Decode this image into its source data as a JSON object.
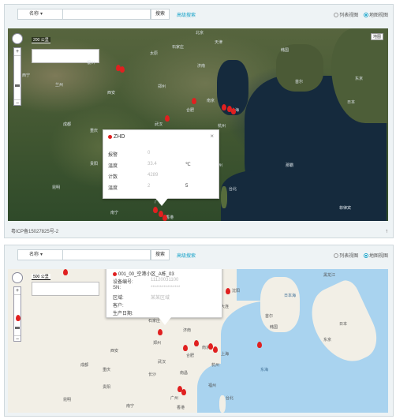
{
  "colors": {
    "accent": "#1aa3c9",
    "pin": "#e02020"
  },
  "panel1": {
    "toolbar": {
      "select": "名称",
      "select_caret": "▾",
      "search_placeholder": "",
      "search_btn": "搜索",
      "advanced": "高级搜索",
      "view_list": "列表视图",
      "view_map": "地图视图"
    },
    "map": {
      "scale": "200 公里",
      "maptype": "地图",
      "zoom_in": "+",
      "zoom_out": "−",
      "labels": [
        "西宁",
        "兰州",
        "银川",
        "太原",
        "北京",
        "天津",
        "石家庄",
        "济南",
        "郑州",
        "西安",
        "南京",
        "合肥",
        "上海",
        "杭州",
        "武汉",
        "长沙",
        "南昌",
        "福州",
        "台北",
        "成都",
        "重庆",
        "贵阳",
        "昆明",
        "南宁",
        "广州",
        "香港",
        "首尔",
        "韩国",
        "东京",
        "日本",
        "那霸",
        "菲律宾"
      ],
      "footer": "粤ICP备15027825号-2"
    },
    "popup": {
      "title": "ZHD",
      "close": "×",
      "rows": [
        {
          "k": "报警",
          "v": "0",
          "u": ""
        },
        {
          "k": "温度",
          "v": "33.4",
          "u": "℃"
        },
        {
          "k": "计数",
          "v": "4289",
          "u": ""
        },
        {
          "k": "温度",
          "v": "2",
          "u": "5"
        }
      ]
    }
  },
  "panel2": {
    "toolbar": {
      "select": "名称",
      "select_caret": "▾",
      "search_btn": "搜索",
      "advanced": "高级搜索",
      "view_list": "列表视图",
      "view_map": "地图视图"
    },
    "map": {
      "scale": "500 公里",
      "zoom_in": "+",
      "zoom_out": "−",
      "labels": [
        "黑龙江",
        "北京",
        "天津",
        "石家庄",
        "沈阳",
        "大连",
        "济南",
        "郑州",
        "西安",
        "南京",
        "合肥",
        "上海",
        "杭州",
        "武汉",
        "长沙",
        "南昌",
        "福州",
        "台北",
        "成都",
        "重庆",
        "贵阳",
        "昆明",
        "南宁",
        "广州",
        "香港",
        "首尔",
        "东京",
        "日本",
        "日本海",
        "东海",
        "韩国"
      ]
    },
    "popup": {
      "title": "001_00_空港小区_A栋_03",
      "rows": [
        {
          "k": "设备编号:",
          "v": "11120031100"
        },
        {
          "k": "SN:",
          "v": "****************"
        },
        {
          "k": "区域:",
          "v": "某某区域"
        },
        {
          "k": "客户:",
          "v": ""
        },
        {
          "k": "生产日期:",
          "v": ""
        }
      ]
    }
  }
}
